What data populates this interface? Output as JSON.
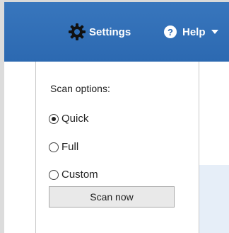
{
  "header": {
    "settings_label": "Settings",
    "help_label": "Help",
    "settings_icon": "gear-icon",
    "help_icon": "question-icon",
    "help_glyph": "?",
    "background_color": "#2e6db4"
  },
  "scan_panel": {
    "label": "Scan options:",
    "options": [
      {
        "label": "Quick",
        "selected": true
      },
      {
        "label": "Full",
        "selected": false
      },
      {
        "label": "Custom",
        "selected": false
      }
    ],
    "button_label": "Scan now"
  }
}
